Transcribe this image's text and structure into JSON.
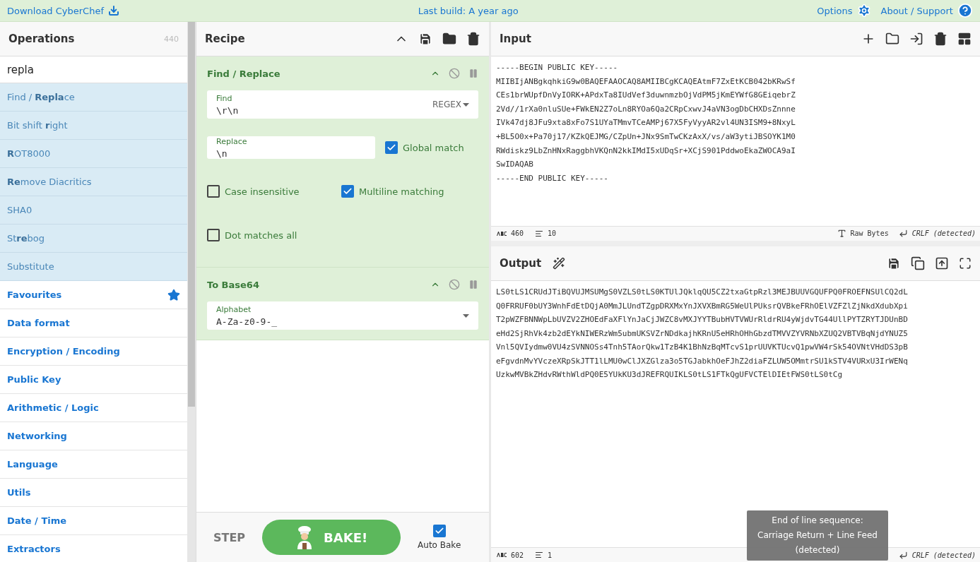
{
  "top_bar": {
    "download_label": "Download CyberChef",
    "build_label": "Last build: A year ago",
    "options_label": "Options",
    "about_label": "About / Support"
  },
  "operations": {
    "title": "Operations",
    "count": "440",
    "search_value": "repla",
    "results": [
      {
        "label": "Find / **Repla**ce"
      },
      {
        "label": "Bit shift **r**ight"
      },
      {
        "label": "**R**OT8000"
      },
      {
        "label": "**Re**move Diacritics"
      },
      {
        "label": "SHA0"
      },
      {
        "label": "St**re**bog"
      },
      {
        "label": "Substitute"
      }
    ],
    "categories": [
      {
        "label": "Favourites",
        "kind": "favourites"
      },
      {
        "label": "Data format",
        "kind": "category"
      },
      {
        "label": "Encryption / Encoding",
        "kind": "category"
      },
      {
        "label": "Public Key",
        "kind": "category"
      },
      {
        "label": "Arithmetic / Logic",
        "kind": "category"
      },
      {
        "label": "Networking",
        "kind": "category"
      },
      {
        "label": "Language",
        "kind": "category"
      },
      {
        "label": "Utils",
        "kind": "category"
      },
      {
        "label": "Date / Time",
        "kind": "category"
      },
      {
        "label": "Extractors",
        "kind": "category"
      }
    ]
  },
  "recipe": {
    "title": "Recipe",
    "operations": [
      {
        "kind": "find_replace",
        "title": "Find / Replace",
        "find": {
          "label": "Find",
          "value": "\\r\\n",
          "mode": "REGEX"
        },
        "replace": {
          "label": "Replace",
          "value": "\\n"
        },
        "options": [
          {
            "label": "Global match",
            "checked": true
          },
          {
            "label": "Case insensitive",
            "checked": false
          },
          {
            "label": "Multiline matching",
            "checked": true
          },
          {
            "label": "Dot matches all",
            "checked": false
          }
        ]
      },
      {
        "kind": "to_base64",
        "title": "To Base64",
        "alphabet": {
          "label": "Alphabet",
          "value": "A-Za-z0-9-_"
        }
      }
    ],
    "step_label": "STEP",
    "bake_label": "BAKE!",
    "auto_bake": {
      "label": "Auto Bake",
      "checked": true
    }
  },
  "input": {
    "title": "Input",
    "lines": [
      "-----BEGIN PUBLIC KEY-----",
      "MIIBIjANBgkqhkiG9w0BAQEFAAOCAQ8AMIIBCgKCAQEAtmF7ZxEtKCB042bKRwSf",
      "CEs1brWUpfDnVyIORK+APdxTa8IUdVef3duwnmzbOjVdPM5jKmEYWfG8GEiqebrZ",
      "2Vd//1rXa0nluSUe+FWkEN2Z7oLn8RYOa6Qa2CRpCxwvJ4aVN3ogDbCHXDsZnnne",
      "IVk47dj8JFu9xta8xFo7S1UYaTMmvTCeAMPj67X5FyVyyAR2vl4UN3ISM9+8NxyL",
      "+BL5O0x+Pa70j17/KZkQEJMG/CZpUn+JNx9SmTwCKzAxX/vs/aW3ytiJBSOYK1M0",
      "RWdiskz9LbZnHNxRaggbhVKQnN2kkIMdI5xUDqSr+XCjS901PddwoEkaZWOCA9aI",
      "SwIDAQAB",
      "-----END PUBLIC KEY-----"
    ],
    "status": {
      "chars": "460",
      "lines": "10",
      "encoding": "Raw Bytes",
      "eol": "CRLF (detected)"
    }
  },
  "output": {
    "title": "Output",
    "lines": [
      "LS0tLS1CRUdJTiBQVUJMSUMgS0VZLS0tLS0KTUlJQklqQU5CZ2txaGtpRzl3MEJBUUVGQUFPQ0FROEFNSUlCQ2dL",
      "Q0FRRUF0bUY3WnhFdEtDQjA0MmJLUndTZgpDRXMxYnJXVXBmRG5WeUlPUksrQVBkeFRhOElVZFZlZjNkdXdubXpi",
      "T2pWZFBNNWpLbUVZV2ZHOEdFaXFlYnJaCjJWZC8vMXJYYTBubHVTVWUrRldrRU4yWjdvTG44UllPYTZRYTJDUnBD",
      "eHd2SjRhVk4zb2dEYkNIWERzWm5ubmUKSVZrNDdkajhKRnU5eHRhOHhGbzdTMVVZYVRNbXZUQ2VBTVBqNjdYNUZ5",
      "Vnl5QVIydmw0VU4zSVNNOSs4Tnh5TAorQkw1TzB4K1BhNzBqMTcvS1prUUVKTUcvQ1pwVW4rSk54OVNtVHdDS3pB",
      "eFgvdnMvYVczeXRpSkJTT1lLMU0wClJXZGlza3o5TGJabkhOeFJhZ2diaFZLUW5OMmtrSU1kSTV4VURxU3IrWENq",
      "UzkwMVBkZHdvRWthWldPQ0E5YUkKU3dJREFRQUIKLS0tLS1FTkQgUFVCTElDIEtFWS0tLS0tCg"
    ],
    "status": {
      "chars": "602",
      "lines": "1",
      "eol": "CRLF (detected)"
    }
  },
  "tooltip": {
    "lines": [
      "End of line sequence:",
      "Carriage Return + Line Feed",
      "(detected)"
    ]
  }
}
